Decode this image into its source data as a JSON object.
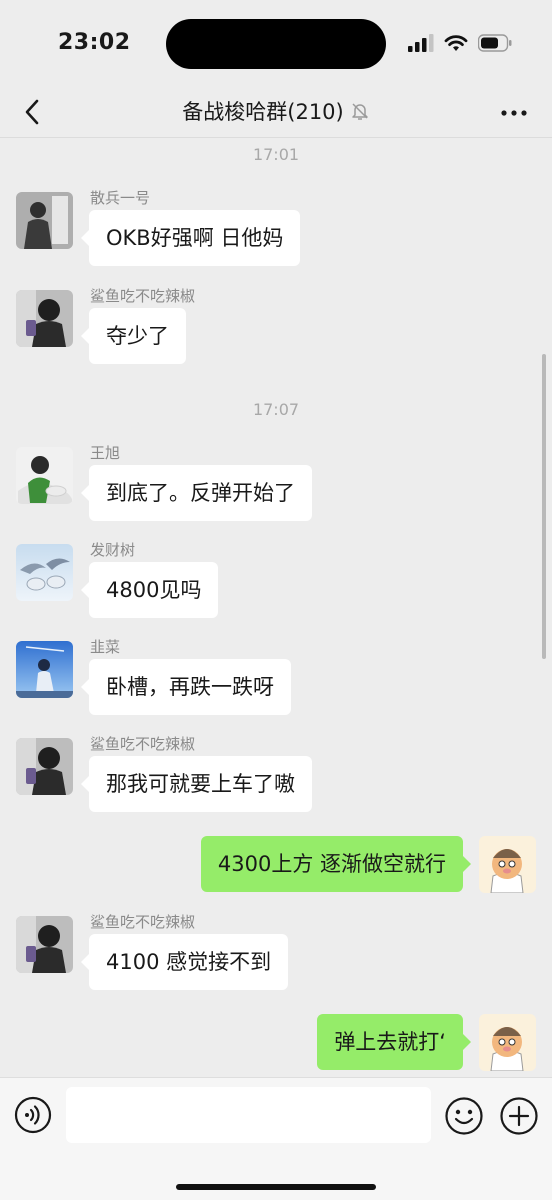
{
  "status_bar": {
    "time": "23:02",
    "icons": [
      "signal-icon",
      "wifi-icon",
      "battery-icon"
    ]
  },
  "nav": {
    "title": "备战梭哈群(210)",
    "icons": {
      "back": "chevron-left-icon",
      "muted": "bell-off-icon",
      "more": "more-icon"
    }
  },
  "timestamps": [
    "17:01",
    "17:07"
  ],
  "messages": [
    {
      "direction": "incoming",
      "sender": "散兵一号",
      "text": "OKB好强啊 日他妈",
      "avatar_color": "#6f6f6f"
    },
    {
      "direction": "incoming",
      "sender": "鲨鱼吃不吃辣椒",
      "text": "夺少了",
      "avatar_color": "#5c5c5c"
    },
    {
      "direction": "incoming",
      "sender": "王旭",
      "text": "到底了。反弹开始了",
      "avatar_color": "#3e8f3a"
    },
    {
      "direction": "incoming",
      "sender": "发财树",
      "text": "4800见吗",
      "avatar_color": "#9ec3e6"
    },
    {
      "direction": "incoming",
      "sender": "韭菜",
      "text": "卧槽，再跌一跌呀",
      "avatar_color": "#3f7fd8"
    },
    {
      "direction": "incoming",
      "sender": "鲨鱼吃不吃辣椒",
      "text": "那我可就要上车了嗷",
      "avatar_color": "#5c5c5c"
    },
    {
      "direction": "outgoing",
      "text": "4300上方 逐渐做空就行"
    },
    {
      "direction": "incoming",
      "sender": "鲨鱼吃不吃辣椒",
      "text": "4100 感觉接不到",
      "avatar_color": "#5c5c5c"
    },
    {
      "direction": "outgoing",
      "text": "弹上去就打‘"
    }
  ],
  "colors": {
    "background": "#ededed",
    "incoming_bubble": "#ffffff",
    "outgoing_bubble": "#95ec69"
  },
  "input_bar": {
    "value": "",
    "icons": [
      "voice-icon",
      "emoji-icon",
      "plus-icon"
    ]
  }
}
